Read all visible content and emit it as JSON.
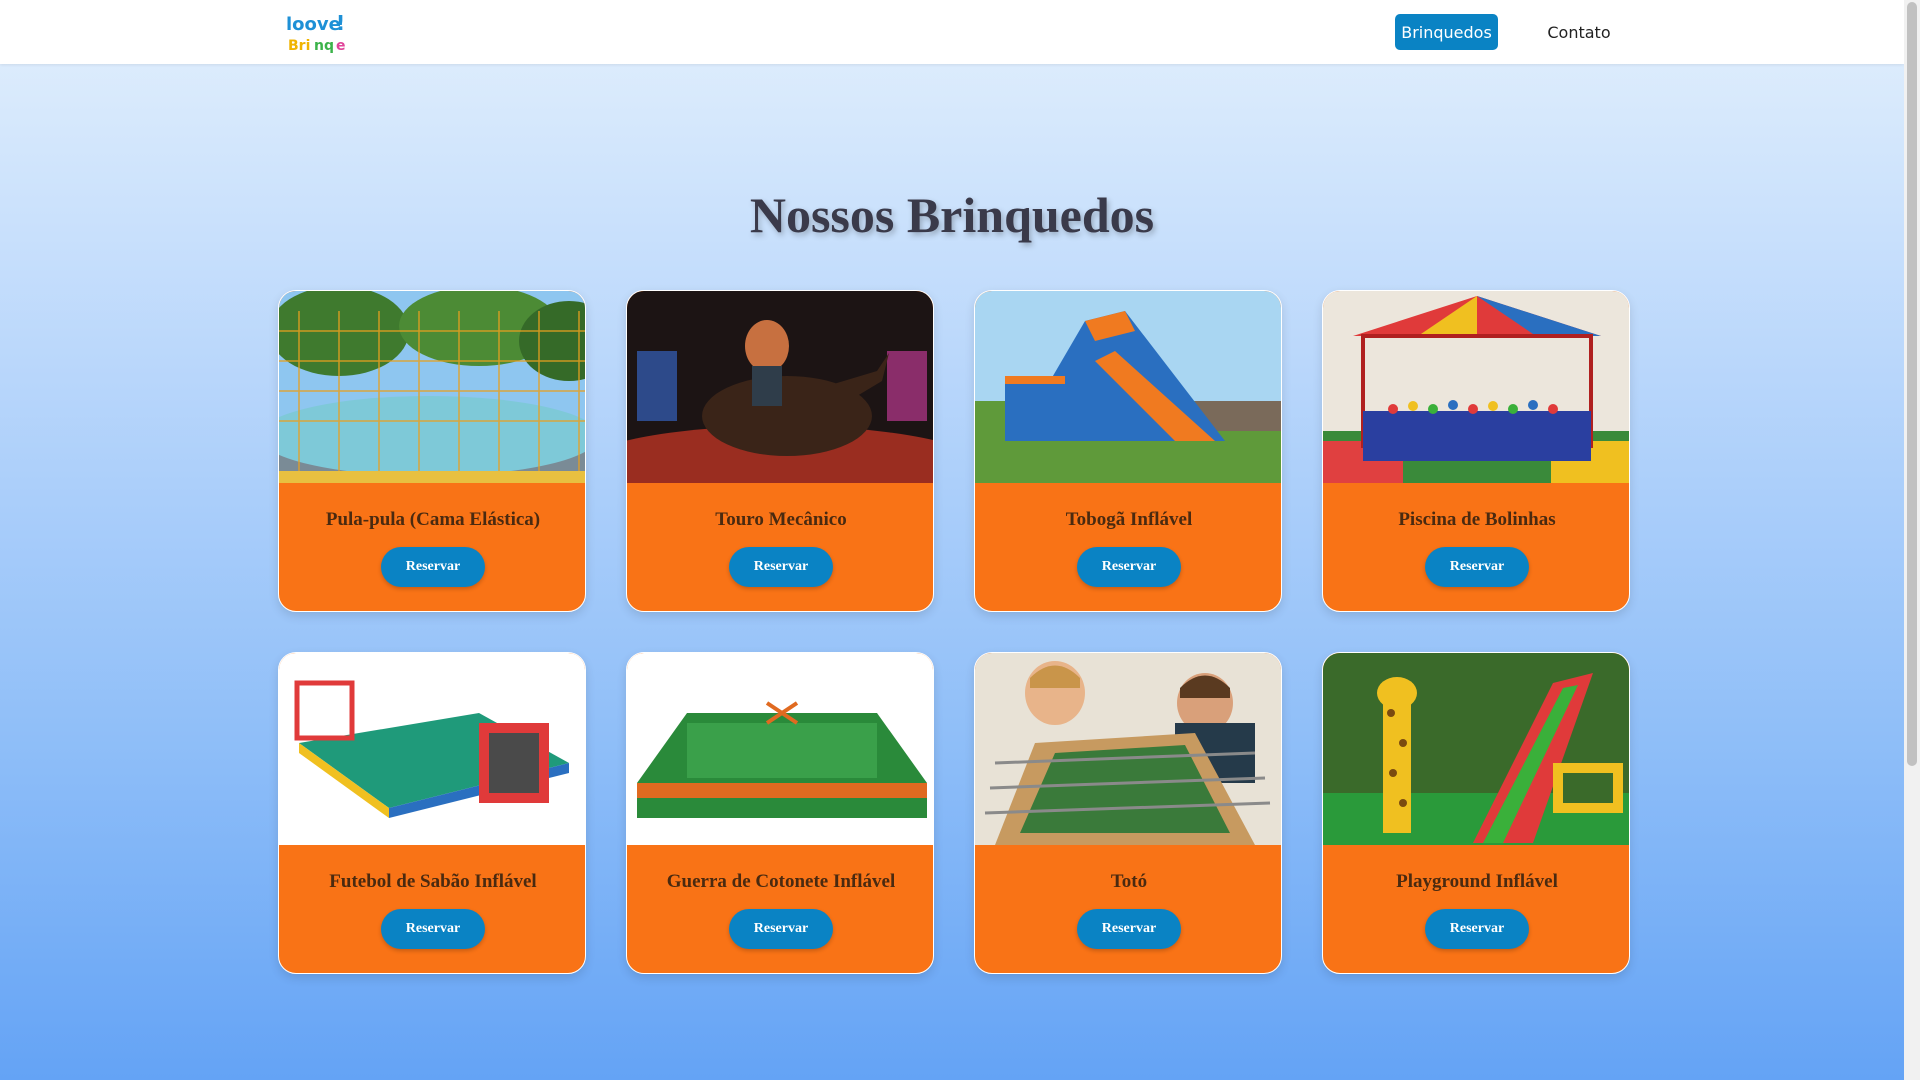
{
  "nav": {
    "logo_text": "loove! Brinque",
    "links": [
      {
        "label": "Brinquedos"
      },
      {
        "label": "Contato"
      }
    ]
  },
  "section": {
    "title_regular": "Nossos",
    "title_bold": "Brinquedos"
  },
  "cards": [
    {
      "title": "Pula-pula (Cama Elástica)",
      "button": "Reservar",
      "image_icon": "trampoline-photo"
    },
    {
      "title": "Touro Mecânico",
      "button": "Reservar",
      "image_icon": "mechanical-bull-photo"
    },
    {
      "title": "Tobogã Inflável",
      "button": "Reservar",
      "image_icon": "inflatable-slide-photo"
    },
    {
      "title": "Piscina de Bolinhas",
      "button": "Reservar",
      "image_icon": "ball-pit-photo"
    },
    {
      "title": "Futebol de Sabão Inflável",
      "button": "Reservar",
      "image_icon": "soap-football-photo"
    },
    {
      "title": "Guerra de Cotonete Inflável",
      "button": "Reservar",
      "image_icon": "cotton-swab-arena-photo"
    },
    {
      "title": "Totó",
      "button": "Reservar",
      "image_icon": "foosball-photo"
    },
    {
      "title": "Playground Inflável",
      "button": "Reservar",
      "image_icon": "inflatable-playground-photo"
    }
  ],
  "colors": {
    "accent_blue": "#0a83c4",
    "card_orange": "#f97316"
  }
}
